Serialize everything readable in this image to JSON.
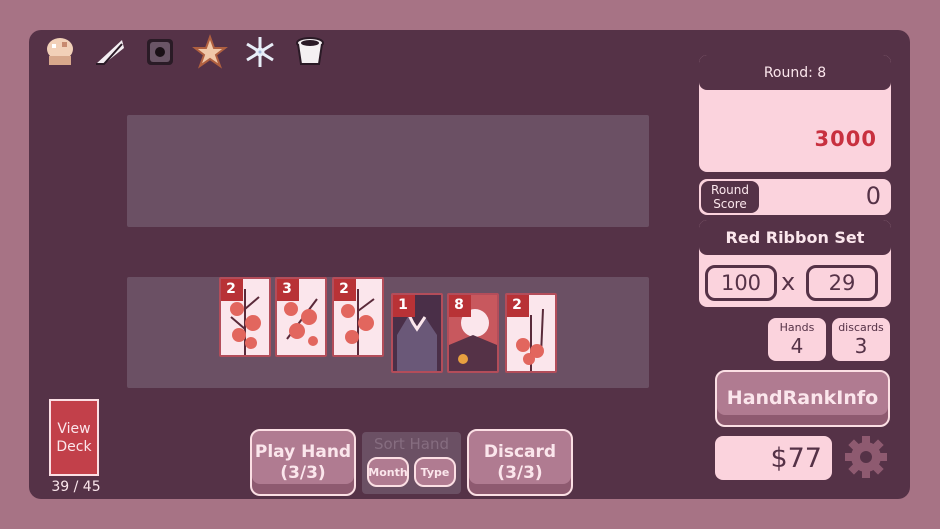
{
  "jokers": [
    {
      "icon": "bell-jellyfish-icon"
    },
    {
      "icon": "feather-fan-icon"
    },
    {
      "icon": "dark-cube-icon"
    },
    {
      "icon": "star-burst-icon"
    },
    {
      "icon": "snowflake-icon"
    },
    {
      "icon": "pail-icon"
    }
  ],
  "hand_cards": [
    {
      "month": "2",
      "suit": "plum"
    },
    {
      "month": "3",
      "suit": "cherry"
    },
    {
      "month": "2",
      "suit": "plum"
    },
    {
      "month": "1",
      "suit": "pine"
    },
    {
      "month": "8",
      "suit": "moon"
    },
    {
      "month": "2",
      "suit": "plum"
    }
  ],
  "deck": {
    "view_label_1": "View",
    "view_label_2": "Deck",
    "count": "39 / 45"
  },
  "buttons": {
    "play_label": "Play Hand",
    "play_count": "(3/3)",
    "sort_label": "Sort Hand",
    "sort_month": "Month",
    "sort_type": "Type",
    "discard_label": "Discard",
    "discard_count": "(3/3)",
    "hand_rank_info": "HandRankInfo"
  },
  "status": {
    "round_label": "Round: 8",
    "target_score": "3000",
    "round_score_label_1": "Round",
    "round_score_label_2": "Score",
    "round_score": "0",
    "hand_name": "Red Ribbon Set",
    "chips": "100",
    "times": "x",
    "mult": "29",
    "hands_label": "Hands",
    "hands_value": "4",
    "discards_label": "discards",
    "discards_value": "3",
    "money": "$77"
  },
  "colors": {
    "accent_red": "#c8303f",
    "panel_pink": "#fbd3dd",
    "board": "#553247"
  }
}
